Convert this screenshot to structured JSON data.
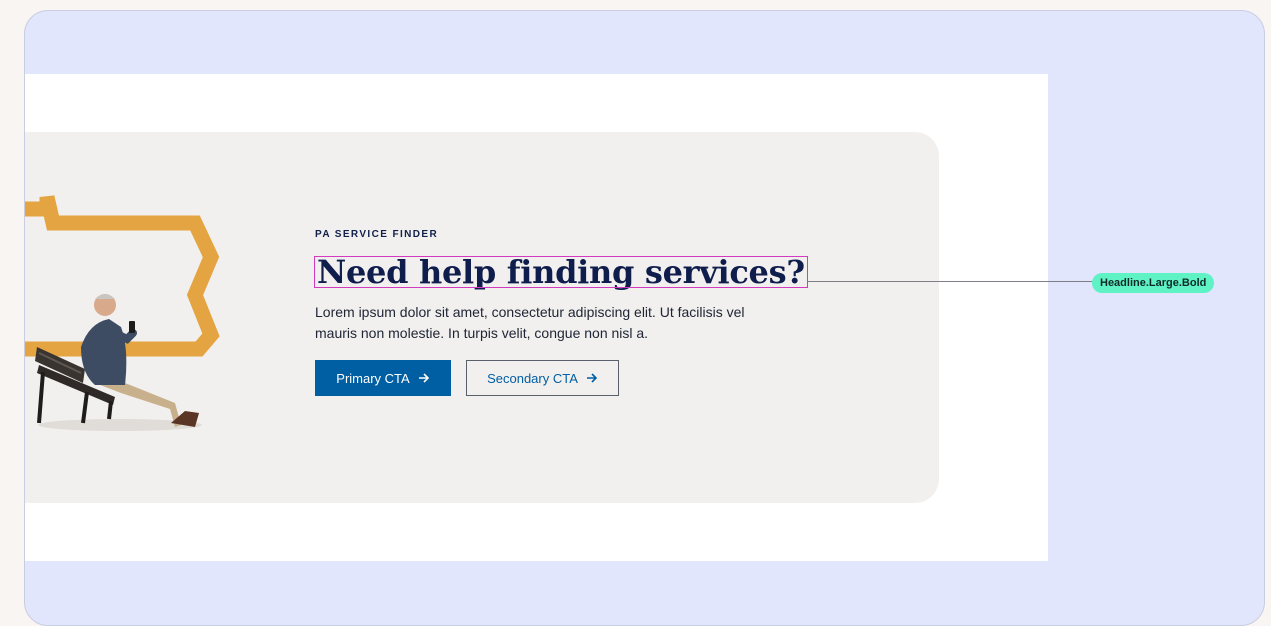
{
  "hero": {
    "eyebrow": "PA SERVICE FINDER",
    "headline": "Need help finding services?",
    "body": "Lorem ipsum dolor sit amet, consectetur adipiscing elit. Ut facilisis vel mauris non molestie. In turpis velit, congue non nisl a.",
    "primary_cta": "Primary CTA",
    "secondary_cta": "Secondary CTA",
    "art": {
      "shape_color": "#e4a441",
      "subject": "man-on-bench-with-phone"
    }
  },
  "annotation": {
    "style_label": "Headline.Large.Bold",
    "badge_color": "#5ef2c5"
  },
  "colors": {
    "canvas_bg": "#e1e6fd",
    "card_bg": "#f2f0ee",
    "headline": "#0f1d4d",
    "primary": "#005ea3"
  }
}
